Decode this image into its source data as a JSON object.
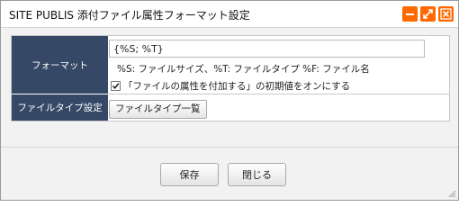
{
  "window": {
    "title": "SITE PUBLIS 添付ファイル属性フォーマット設定",
    "controls": {
      "accent": "#ff6a00",
      "minimize_icon": "minimize-icon",
      "maximize_icon": "maximize-icon",
      "close_icon": "close-icon"
    }
  },
  "form": {
    "format_label": "フォーマット",
    "format_value": "{%S; %T}",
    "format_hint": "%S: ファイルサイズ、%T: ファイルタイプ %F: ファイル名",
    "attr_checkbox_checked": true,
    "attr_checkbox_label": "「ファイルの属性を付加する」の初期値をオンにする",
    "filetype_label": "ファイルタイプ設定",
    "filetype_button": "ファイルタイプ一覧",
    "label_bg": "#354866"
  },
  "footer": {
    "save_label": "保存",
    "close_label": "閉じる"
  }
}
